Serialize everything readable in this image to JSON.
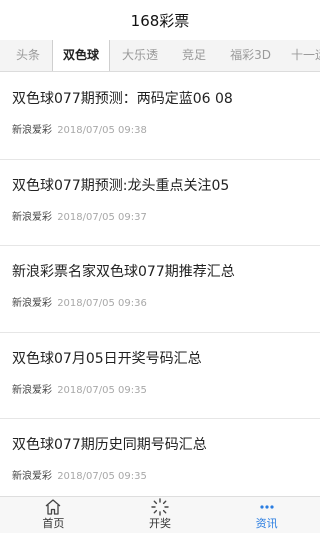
{
  "header": {
    "title": "168彩票"
  },
  "tabs": [
    {
      "label": "头条"
    },
    {
      "label": "双色球"
    },
    {
      "label": "大乐透"
    },
    {
      "label": "竞足"
    },
    {
      "label": "福彩3D"
    },
    {
      "label": "十一运"
    }
  ],
  "active_tab": "双色球",
  "articles": [
    {
      "title": "双色球077期预测：两码定蓝06 08",
      "source": "新浪爱彩",
      "time": "2018/07/05 09:38"
    },
    {
      "title": "双色球077期预测:龙头重点关注05",
      "source": "新浪爱彩",
      "time": "2018/07/05 09:37"
    },
    {
      "title": "新浪彩票名家双色球077期推荐汇总",
      "source": "新浪爱彩",
      "time": "2018/07/05 09:36"
    },
    {
      "title": "双色球07月05日开奖号码汇总",
      "source": "新浪爱彩",
      "time": "2018/07/05 09:35"
    },
    {
      "title": "双色球077期历史同期号码汇总",
      "source": "新浪爱彩",
      "time": "2018/07/05 09:35"
    }
  ],
  "tabbar": [
    {
      "label": "首页",
      "icon": "home-icon"
    },
    {
      "label": "开奖",
      "icon": "loading-spinner-icon"
    },
    {
      "label": "资讯",
      "icon": "more-dots-icon"
    }
  ],
  "colors": {
    "accent": "#2a7de1",
    "tab_bg": "#f4f4f4",
    "muted_text": "#a8a8a8"
  }
}
